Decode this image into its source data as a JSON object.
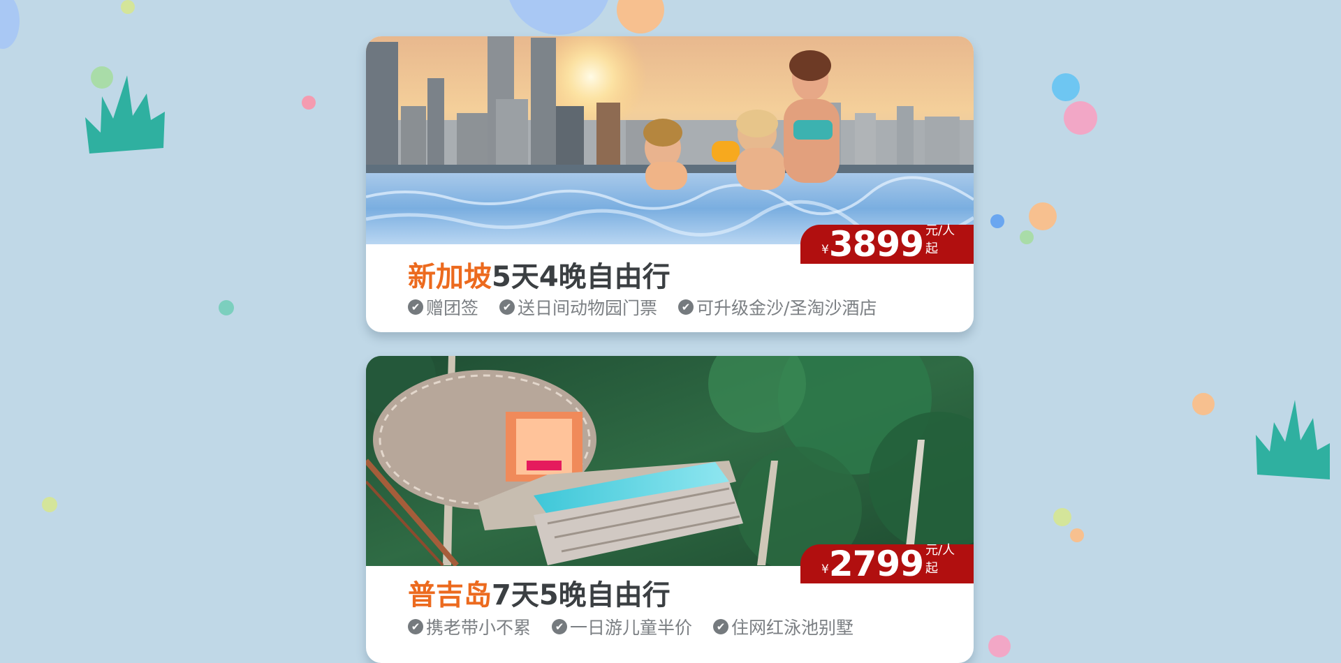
{
  "theme": {
    "background": "#c0d8e7",
    "accent_orange": "#ec6a1e",
    "price_red": "#b10f0f",
    "grass_teal": "#2fb0a0"
  },
  "cards": [
    {
      "place": "新加坡",
      "title_rest": "5天4晚自由行",
      "price_symbol": "¥",
      "price": "3899",
      "price_unit": "元/人起",
      "image": "singapore-infinity-pool-photo",
      "features": [
        {
          "icon": "check-circle-icon",
          "text": "赠团签"
        },
        {
          "icon": "check-circle-icon",
          "text": "送日间动物园门票"
        },
        {
          "icon": "check-circle-icon",
          "text": "可升级金沙/圣淘沙酒店"
        }
      ]
    },
    {
      "place": "普吉岛",
      "title_rest": "7天5晚自由行",
      "price_symbol": "¥",
      "price": "2799",
      "price_unit": "元/人起",
      "image": "phuket-treehouse-pool-photo",
      "features": [
        {
          "icon": "check-circle-icon",
          "text": "携老带小不累"
        },
        {
          "icon": "check-circle-icon",
          "text": "一日游儿童半价"
        },
        {
          "icon": "check-circle-icon",
          "text": "住网红泳池别墅"
        }
      ]
    }
  ]
}
